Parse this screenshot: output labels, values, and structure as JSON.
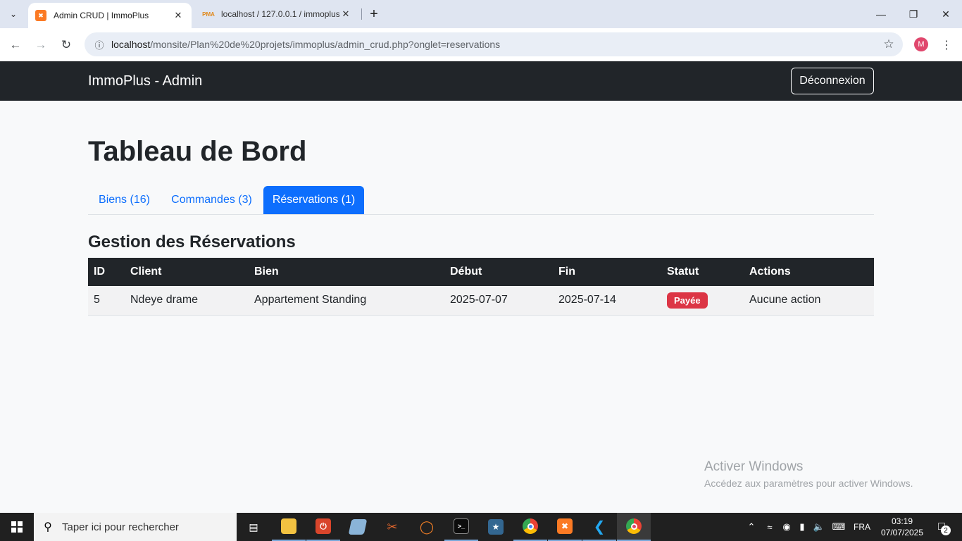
{
  "browser": {
    "tabs": [
      {
        "title": "Admin CRUD | ImmoPlus",
        "favicon": "xampp-icon",
        "active": true
      },
      {
        "title": "localhost / 127.0.0.1 / immoplus",
        "favicon": "phpmyadmin-icon",
        "active": false
      }
    ],
    "url_host": "localhost",
    "url_path": "/monsite/Plan%20de%20projets/immoplus/admin_crud.php?onglet=reservations",
    "profile_initial": "M"
  },
  "navbar": {
    "brand": "ImmoPlus - Admin",
    "logout_label": "Déconnexion"
  },
  "page": {
    "title": "Tableau de Bord",
    "tabs": [
      {
        "label": "Biens (16)",
        "active": false
      },
      {
        "label": "Commandes (3)",
        "active": false
      },
      {
        "label": "Réservations (1)",
        "active": true
      }
    ],
    "section_title": "Gestion des Réservations"
  },
  "table": {
    "headers": [
      "ID",
      "Client",
      "Bien",
      "Début",
      "Fin",
      "Statut",
      "Actions"
    ],
    "rows": [
      {
        "id": "5",
        "client": "Ndeye drame",
        "bien": "Appartement Standing",
        "debut": "2025-07-07",
        "fin": "2025-07-14",
        "statut": "Payée",
        "actions": "Aucune action"
      }
    ]
  },
  "watermark": {
    "line1": "Activer Windows",
    "line2": "Accédez aux paramètres pour activer Windows."
  },
  "taskbar": {
    "search_placeholder": "Taper ici pour rechercher",
    "language": "FRA",
    "time": "03:19",
    "date": "07/07/2025",
    "notification_count": "2"
  },
  "colors": {
    "navbar_bg": "#212529",
    "primary": "#0d6efd",
    "danger": "#dc3545",
    "page_bg": "#f8f9fa"
  }
}
